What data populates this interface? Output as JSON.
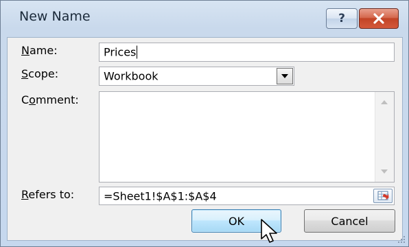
{
  "window": {
    "title": "New Name",
    "help_label": "?",
    "close_icon": "close-x-icon"
  },
  "form": {
    "name_label_mnemonic": "N",
    "name_label_rest": "ame:",
    "name_value": "Prices",
    "scope_label_mnemonic": "S",
    "scope_label_rest": "cope:",
    "scope_value": "Workbook",
    "comment_label_pre": "C",
    "comment_label_mnemonic": "o",
    "comment_label_rest": "mment:",
    "comment_value": "",
    "refers_label_mnemonic": "R",
    "refers_label_rest": "efers to:",
    "refers_value": "=Sheet1!$A$1:$A$4"
  },
  "buttons": {
    "ok_label": "OK",
    "cancel_label": "Cancel"
  },
  "colors": {
    "title_bar": "#d7e4f2",
    "close_button": "#c24426",
    "ok_button": "#bee6fd"
  }
}
